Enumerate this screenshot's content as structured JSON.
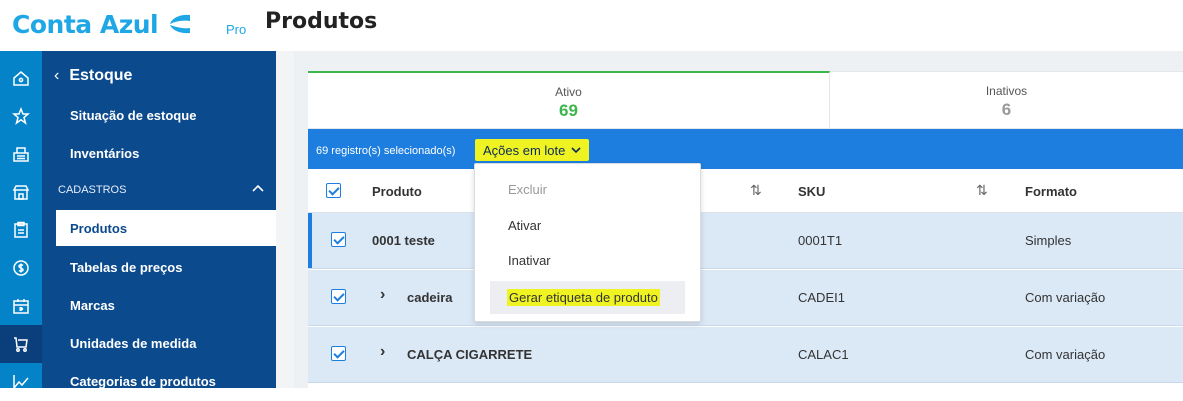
{
  "header": {
    "brand": "Conta Azul",
    "brand_suffix": "Pro",
    "page_title": "Produtos",
    "brand_color": "#1ea7e4"
  },
  "rail": {
    "icons": [
      "home-icon",
      "star-icon",
      "register-icon",
      "store-icon",
      "clipboard-icon",
      "dollar-icon",
      "calendar-icon",
      "cart-icon",
      "chart-icon"
    ],
    "active_index": 7
  },
  "sidebar": {
    "title": "Estoque",
    "items": [
      {
        "label": "Situação de estoque"
      },
      {
        "label": "Inventários"
      }
    ],
    "section": {
      "label": "CADASTROS"
    },
    "section_items": [
      {
        "label": "Produtos",
        "active": true
      },
      {
        "label": "Tabelas de preços"
      },
      {
        "label": "Marcas"
      },
      {
        "label": "Unidades de medida"
      },
      {
        "label": "Categorias de produtos"
      }
    ]
  },
  "tabs": [
    {
      "label": "Ativo",
      "count": "69",
      "active": true
    },
    {
      "label": "Inativos",
      "count": "6"
    }
  ],
  "bulk": {
    "selected_text": "69 registro(s) selecionado(s)",
    "actions_label": "Ações em lote",
    "highlight_color": "#eef321"
  },
  "table": {
    "columns": [
      "Produto",
      "SKU",
      "Formato"
    ],
    "rows": [
      {
        "name": "0001 teste",
        "sku": "0001T1",
        "format": "Simples",
        "expandable": false
      },
      {
        "name": "cadeira",
        "sku": "CADEI1",
        "format": "Com variação",
        "expandable": true
      },
      {
        "name": "CALÇA CIGARRETE",
        "sku": "CALAC1",
        "format": "Com variação",
        "expandable": true
      }
    ]
  },
  "dropdown": {
    "items": [
      {
        "label": "Excluir",
        "disabled": true
      },
      {
        "label": "Ativar"
      },
      {
        "label": "Inativar"
      },
      {
        "label": "Gerar etiqueta de produto",
        "highlighted": true
      }
    ]
  }
}
